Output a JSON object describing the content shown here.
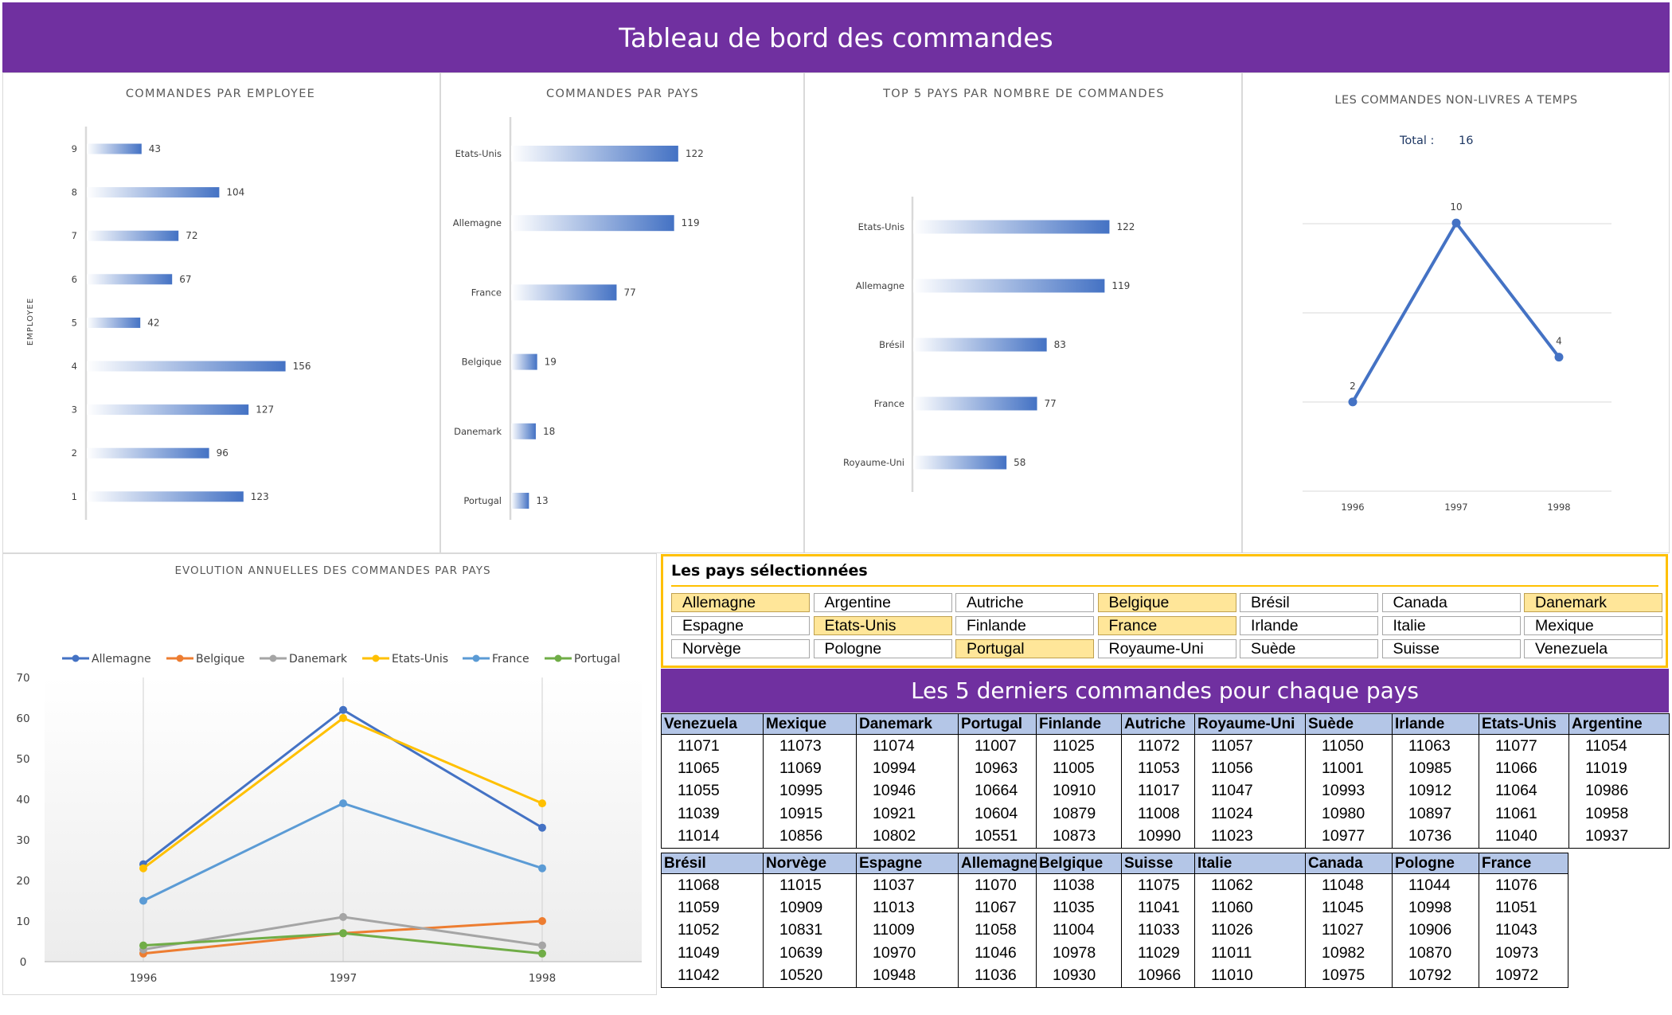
{
  "dashboard": {
    "title": "Tableau de bord des commandes"
  },
  "charts": [
    {
      "type": "bar",
      "orientation": "horizontal",
      "title": "COMMANDES PAR EMPLOYEE",
      "ylabel": "EMPLOYEE",
      "xlabel": "",
      "categories": [
        "9",
        "8",
        "7",
        "6",
        "5",
        "4",
        "3",
        "2",
        "1"
      ],
      "values": [
        43,
        104,
        72,
        67,
        42,
        156,
        127,
        96,
        123
      ],
      "color": "#4472c4"
    },
    {
      "type": "bar",
      "orientation": "horizontal",
      "title": "COMMANDES PAR PAYS",
      "categories": [
        "Etats-Unis",
        "Allemagne",
        "France",
        "Belgique",
        "Danemark",
        "Portugal"
      ],
      "values": [
        122,
        119,
        77,
        19,
        18,
        13
      ],
      "color": "#4472c4"
    },
    {
      "type": "bar",
      "orientation": "horizontal",
      "title": "TOP 5 PAYS PAR NOMBRE DE COMMANDES",
      "categories": [
        "Etats-Unis",
        "Allemagne",
        "Brésil",
        "France",
        "Royaume-Uni"
      ],
      "values": [
        122,
        119,
        83,
        77,
        58
      ],
      "color": "#4472c4"
    },
    {
      "type": "line",
      "title": "LES COMMANDES NON-LIVRES A TEMPS",
      "total_label": "Total :",
      "total_value": "16",
      "x": [
        "1996",
        "1997",
        "1998"
      ],
      "values": [
        2,
        10,
        4
      ],
      "color": "#4472c4"
    },
    {
      "type": "line",
      "title": "EVOLUTION ANNUELLES DES COMMANDES PAR PAYS",
      "x": [
        "1996",
        "1997",
        "1998"
      ],
      "ylim": [
        0,
        70
      ],
      "yticks": [
        "0",
        "10",
        "20",
        "30",
        "40",
        "50",
        "60",
        "70"
      ],
      "legend_position": "top",
      "series": [
        {
          "name": "Allemagne",
          "values": [
            24,
            62,
            33
          ],
          "color": "#4472c4"
        },
        {
          "name": "Belgique",
          "values": [
            2,
            7,
            10
          ],
          "color": "#ed7d31"
        },
        {
          "name": "Danemark",
          "values": [
            3,
            11,
            4
          ],
          "color": "#a5a5a5"
        },
        {
          "name": "Etats-Unis",
          "values": [
            23,
            60,
            39
          ],
          "color": "#ffc000"
        },
        {
          "name": "France",
          "values": [
            15,
            39,
            23
          ],
          "color": "#5b9bd5"
        },
        {
          "name": "Portugal",
          "values": [
            4,
            7,
            2
          ],
          "color": "#70ad47"
        }
      ]
    }
  ],
  "selection": {
    "title": "Les pays sélectionnées",
    "countries": [
      {
        "name": "Allemagne",
        "selected": true
      },
      {
        "name": "Argentine",
        "selected": false
      },
      {
        "name": "Autriche",
        "selected": false
      },
      {
        "name": "Belgique",
        "selected": true
      },
      {
        "name": "Brésil",
        "selected": false
      },
      {
        "name": "Canada",
        "selected": false
      },
      {
        "name": "Danemark",
        "selected": true
      },
      {
        "name": "Espagne",
        "selected": false
      },
      {
        "name": "Etats-Unis",
        "selected": true
      },
      {
        "name": "Finlande",
        "selected": false
      },
      {
        "name": "France",
        "selected": true
      },
      {
        "name": "Irlande",
        "selected": false
      },
      {
        "name": "Italie",
        "selected": false
      },
      {
        "name": "Mexique",
        "selected": false
      },
      {
        "name": "Norvège",
        "selected": false
      },
      {
        "name": "Pologne",
        "selected": false
      },
      {
        "name": "Portugal",
        "selected": true
      },
      {
        "name": "Royaume-Uni",
        "selected": false
      },
      {
        "name": "Suède",
        "selected": false
      },
      {
        "name": "Suisse",
        "selected": false
      },
      {
        "name": "Venezuela",
        "selected": false
      }
    ]
  },
  "orders": {
    "title": "Les 5 derniers commandes pour chaque pays",
    "tables": [
      {
        "headers": [
          "Venezuela",
          "Mexique",
          "Danemark",
          "Portugal",
          "Finlande",
          "Autriche",
          "Royaume-Uni",
          "Suède",
          "Irlande",
          "Etats-Unis",
          "Argentine"
        ],
        "rows": [
          [
            "11071",
            "11073",
            "11074",
            "11007",
            "11025",
            "11072",
            "11057",
            "11050",
            "11063",
            "11077",
            "11054"
          ],
          [
            "11065",
            "11069",
            "10994",
            "10963",
            "11005",
            "11053",
            "11056",
            "11001",
            "10985",
            "11066",
            "11019"
          ],
          [
            "11055",
            "10995",
            "10946",
            "10664",
            "10910",
            "11017",
            "11047",
            "10993",
            "10912",
            "11064",
            "10986"
          ],
          [
            "11039",
            "10915",
            "10921",
            "10604",
            "10879",
            "11008",
            "11024",
            "10980",
            "10897",
            "11061",
            "10958"
          ],
          [
            "11014",
            "10856",
            "10802",
            "10551",
            "10873",
            "10990",
            "11023",
            "10977",
            "10736",
            "11040",
            "10937"
          ]
        ]
      },
      {
        "headers": [
          "Brésil",
          "Norvège",
          "Espagne",
          "Allemagne",
          "Belgique",
          "Suisse",
          "Italie",
          "Canada",
          "Pologne",
          "France"
        ],
        "rows": [
          [
            "11068",
            "11015",
            "11037",
            "11070",
            "11038",
            "11075",
            "11062",
            "11048",
            "11044",
            "11076"
          ],
          [
            "11059",
            "10909",
            "11013",
            "11067",
            "11035",
            "11041",
            "11060",
            "11045",
            "10998",
            "11051"
          ],
          [
            "11052",
            "10831",
            "11009",
            "11058",
            "11004",
            "11033",
            "11026",
            "11027",
            "10906",
            "11043"
          ],
          [
            "11049",
            "10639",
            "10970",
            "11046",
            "10978",
            "11029",
            "11011",
            "10982",
            "10870",
            "10973"
          ],
          [
            "11042",
            "10520",
            "10948",
            "11036",
            "10930",
            "10966",
            "11010",
            "10975",
            "10792",
            "10972"
          ]
        ]
      }
    ]
  }
}
